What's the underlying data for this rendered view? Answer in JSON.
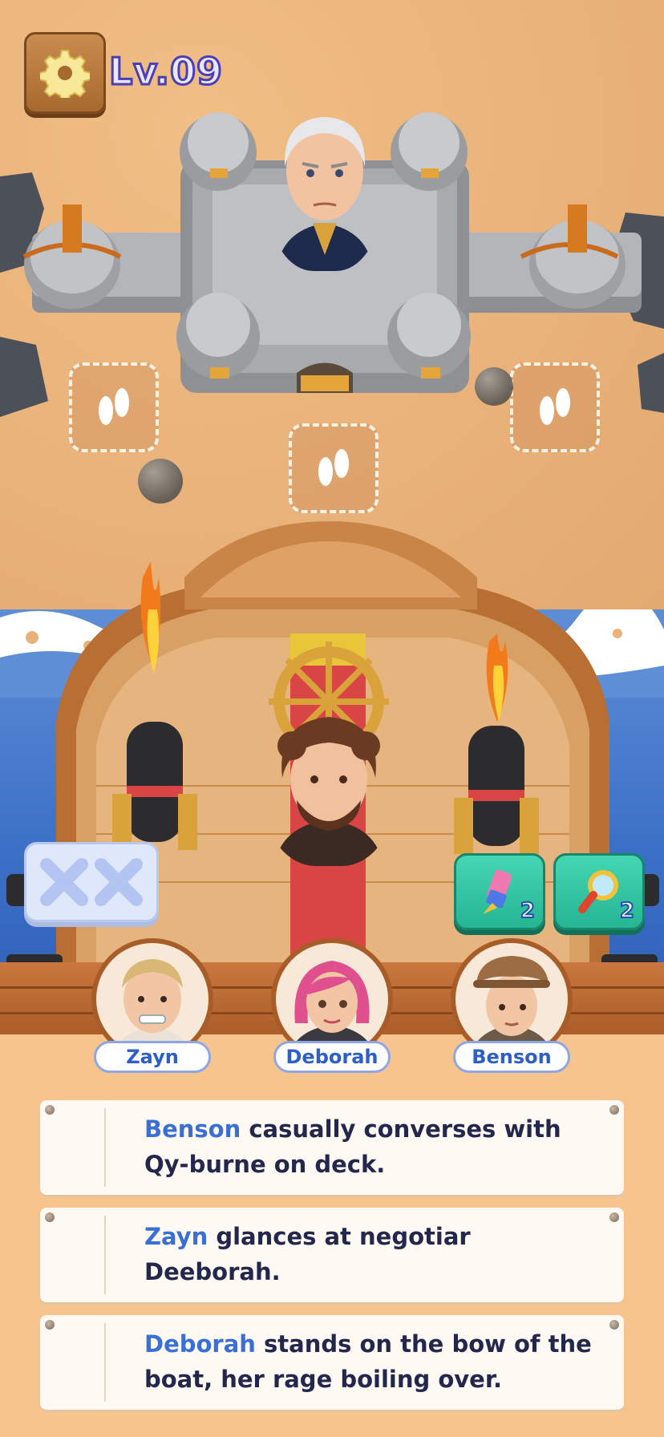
{
  "hud": {
    "level": "Lv.09",
    "settings_icon": "gear-icon"
  },
  "tools": [
    {
      "icon": "eraser-icon",
      "count": "2"
    },
    {
      "icon": "magnifier-icon",
      "count": "2"
    }
  ],
  "characters": [
    {
      "name": "Zayn"
    },
    {
      "name": "Deborah"
    },
    {
      "name": "Benson"
    }
  ],
  "clues": [
    {
      "name": "Benson",
      "text": " casually converses with Qy-burne on deck."
    },
    {
      "name": "Zayn",
      "text": " glances at negotiar Deeborah."
    },
    {
      "name": "Deborah",
      "text": " stands on the bow of the boat, her rage boiling over."
    }
  ],
  "colors": {
    "accent": "#3a6fd6",
    "tool_bg": "#26b592",
    "panel": "#f6c48c"
  }
}
